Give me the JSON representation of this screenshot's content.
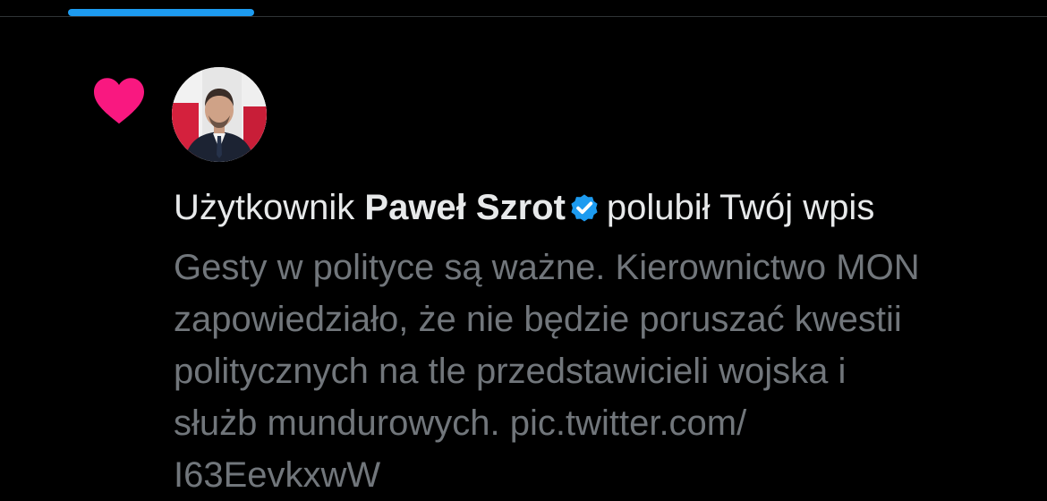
{
  "colors": {
    "background": "#000000",
    "accent": "#1d9bf0",
    "like": "#f91880",
    "primary_text": "#e7e9ea",
    "secondary_text": "#71767b"
  },
  "notification": {
    "icon": "heart-icon",
    "avatar": "user-avatar",
    "headline": {
      "prefix": "Użytkownik",
      "user_name": "Paweł Szrot",
      "verified_icon": "verified-badge-icon",
      "action": "polubił Twój wpis"
    },
    "tweet_lines": [
      "Gesty w polityce są ważne. Kierownictwo MON",
      "zapowiedziało, że nie będzie poruszać kwestii",
      "politycznych na tle przedstawicieli wojska i",
      "służb mundurowych. pic.twitter.com/",
      "I63EevkxwW"
    ]
  }
}
